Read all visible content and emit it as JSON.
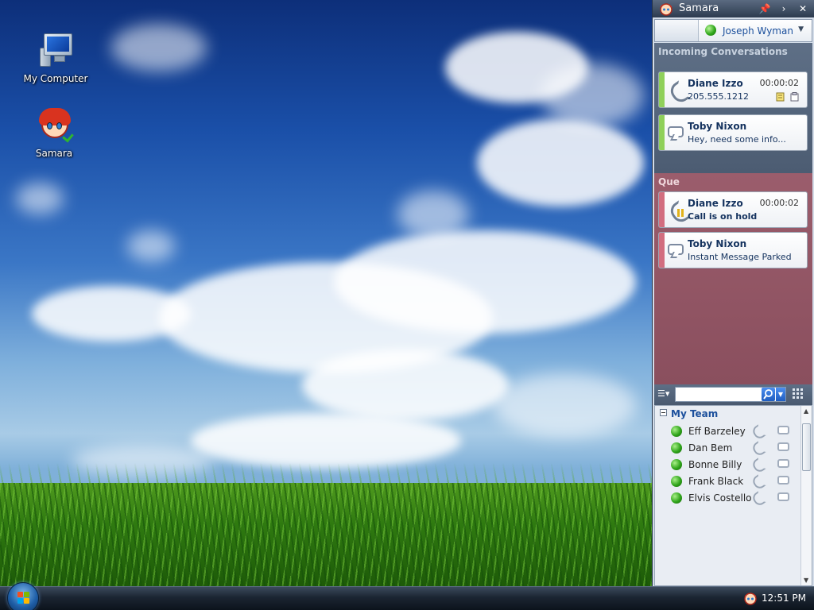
{
  "desktop": {
    "icons": [
      {
        "label": "My Computer",
        "icon": "computer-icon"
      },
      {
        "label": "Samara",
        "icon": "samara-avatar-icon"
      }
    ]
  },
  "app": {
    "title": "Samara",
    "user": {
      "name": "Joseph Wyman",
      "status": "online",
      "status_color": "#31a81c"
    },
    "incoming": {
      "heading": "Incoming Conversations",
      "items": [
        {
          "name": "Diane Izzo",
          "detail": "205.555.1212",
          "time": "00:00:02",
          "type": "call"
        },
        {
          "name": "Toby Nixon",
          "detail": "Hey, need some info...",
          "type": "chat"
        }
      ]
    },
    "queue": {
      "heading": "Que",
      "items": [
        {
          "name": "Diane Izzo",
          "detail": "Call is on hold",
          "time": "00:00:02",
          "type": "call-hold"
        },
        {
          "name": "Toby Nixon",
          "detail": "Instant Message Parked",
          "type": "chat"
        }
      ]
    },
    "search": {
      "value": ""
    },
    "contacts": {
      "group": "My Team",
      "items": [
        {
          "name": "Eff Barzeley",
          "status": "online"
        },
        {
          "name": "Dan Bem",
          "status": "online"
        },
        {
          "name": "Bonne Billy",
          "status": "online"
        },
        {
          "name": "Frank Black",
          "status": "online"
        },
        {
          "name": "Elvis Costello",
          "status": "online"
        }
      ]
    }
  },
  "taskbar": {
    "clock": "12:51 PM"
  },
  "colors": {
    "incoming_bg": "#5e6f86",
    "queue_bg": "#9b5d6c",
    "accent_green": "#8fd05a",
    "accent_red": "#d26d7f",
    "link_blue": "#1b4f9c"
  }
}
